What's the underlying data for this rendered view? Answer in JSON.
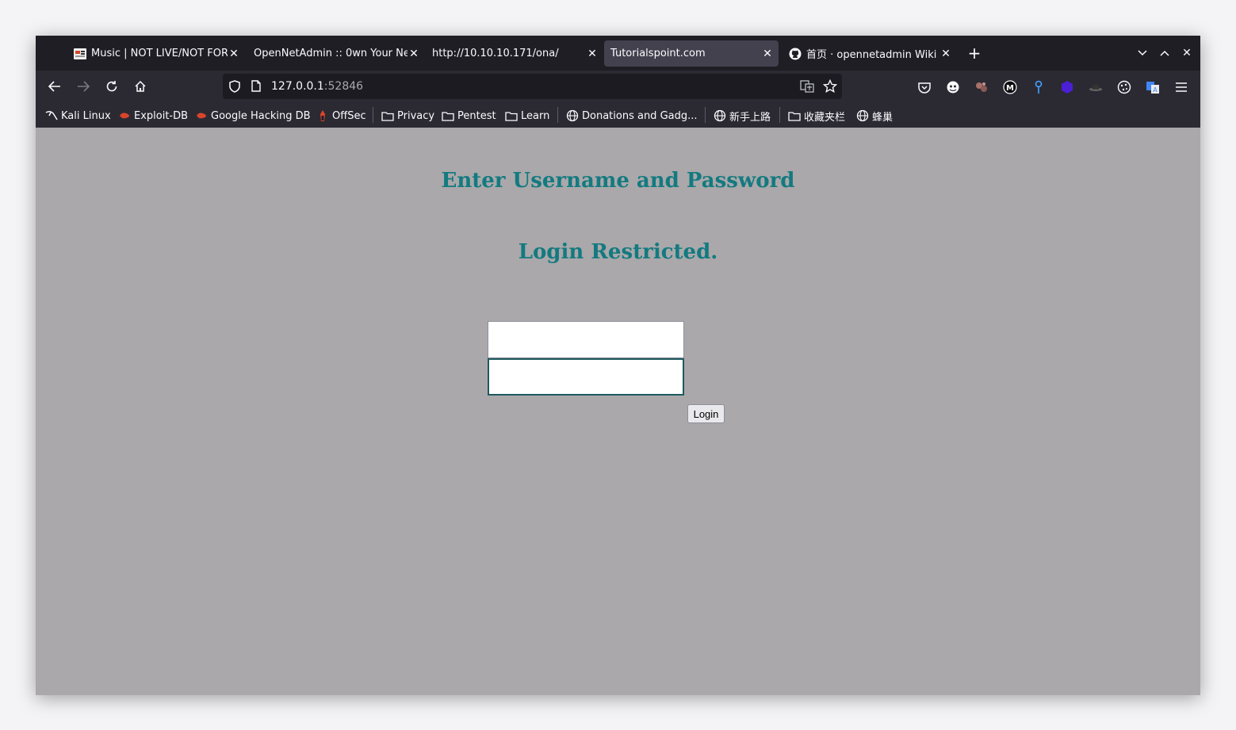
{
  "browser": {
    "tabs": [
      {
        "title": "Music | NOT LIVE/NOT FOR",
        "icon": "music-favicon"
      },
      {
        "title": "OpenNetAdmin :: 0wn Your Ne",
        "icon": ""
      },
      {
        "title": "http://10.10.10.171/ona/",
        "icon": ""
      },
      {
        "title": "Tutorialspoint.com",
        "icon": "",
        "active": true
      },
      {
        "title": "首页 · opennetadmin Wiki",
        "icon": "github-icon"
      }
    ],
    "new_tab_label": "+",
    "url": {
      "host": "127.0.0.1",
      "port": ":52846"
    },
    "bookmarks": [
      {
        "label": "Kali Linux",
        "icon": "kali-icon"
      },
      {
        "label": "Exploit-DB",
        "icon": "exploitdb-icon"
      },
      {
        "label": "Google Hacking DB",
        "icon": "ghdb-icon"
      },
      {
        "label": "OffSec",
        "icon": "offsec-icon"
      },
      {
        "label": "Privacy",
        "icon": "folder-icon"
      },
      {
        "label": "Pentest",
        "icon": "folder-icon"
      },
      {
        "label": "Learn",
        "icon": "folder-icon"
      },
      {
        "label": "Donations and Gadg...",
        "icon": "globe-icon"
      },
      {
        "label": "新手上路",
        "icon": "globe-icon"
      },
      {
        "label": "收藏夹栏",
        "icon": "folder-icon"
      },
      {
        "label": "蜂巢",
        "icon": "globe-icon"
      }
    ]
  },
  "page": {
    "heading": "Enter Username and Password",
    "subheading": "Login Restricted.",
    "username_value": "",
    "password_value": "",
    "login_label": "Login",
    "accent_color": "#137a80",
    "background_color": "#aaa8aa"
  }
}
